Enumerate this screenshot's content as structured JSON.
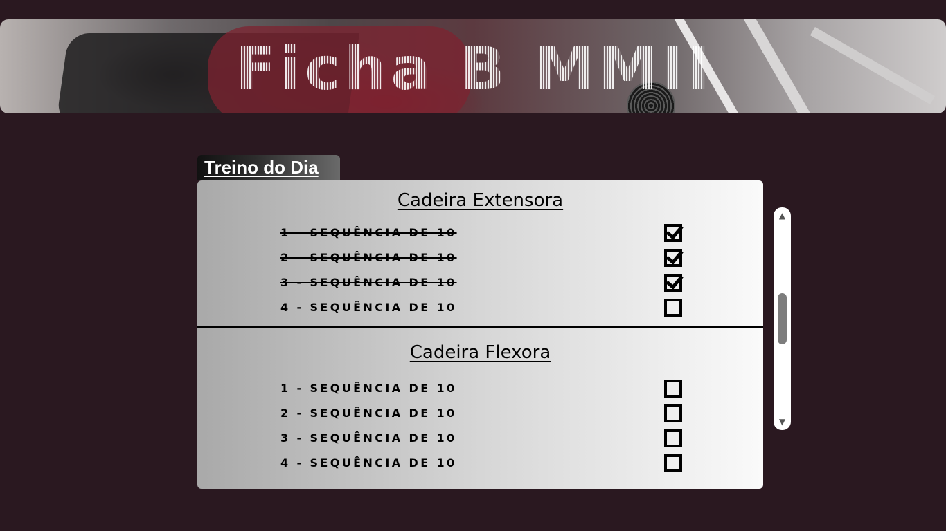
{
  "banner": {
    "title": "Ficha B MMII"
  },
  "section": {
    "label": "Treino do Dia"
  },
  "exercises": [
    {
      "name": "Cadeira Extensora",
      "sets": [
        {
          "label": "1 - SEQUÊNCIA DE 10",
          "done": true
        },
        {
          "label": "2 - SEQUÊNCIA DE 10",
          "done": true
        },
        {
          "label": "3 - SEQUÊNCIA DE 10",
          "done": true
        },
        {
          "label": "4 - SEQUÊNCIA DE 10",
          "done": false
        }
      ]
    },
    {
      "name": "Cadeira Flexora",
      "sets": [
        {
          "label": "1 - SEQUÊNCIA DE 10",
          "done": false
        },
        {
          "label": "2 - SEQUÊNCIA DE 10",
          "done": false
        },
        {
          "label": "3 - SEQUÊNCIA DE 10",
          "done": false
        },
        {
          "label": "4 - SEQUÊNCIA DE 10",
          "done": false
        }
      ]
    }
  ],
  "scrollbar": {
    "up_glyph": "▲",
    "down_glyph": "▼"
  }
}
